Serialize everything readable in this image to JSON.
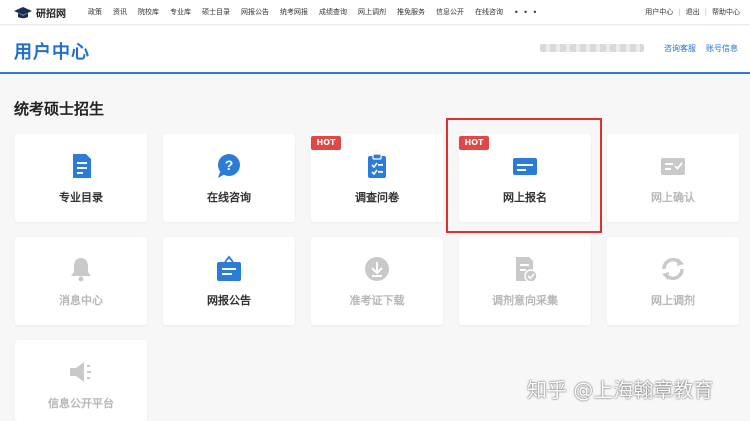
{
  "topbar": {
    "logo_text": "研招网",
    "nav_items": [
      "政策",
      "资讯",
      "院校库",
      "专业库",
      "硕士目录",
      "网报公告",
      "统考网报",
      "成绩查询",
      "网上调剂",
      "推免服务",
      "信息公开",
      "在线咨询"
    ],
    "more": "• • •",
    "right_links": [
      "用户中心",
      "退出",
      "帮助中心"
    ]
  },
  "header": {
    "title": "用户中心",
    "links": [
      "咨询客服",
      "账号信息"
    ]
  },
  "section": {
    "title": "统考硕士招生"
  },
  "hot_label": "HOT",
  "cards": [
    {
      "label": "专业目录",
      "icon": "document-list-icon",
      "hot": false,
      "disabled": false
    },
    {
      "label": "在线咨询",
      "icon": "chat-question-icon",
      "hot": false,
      "disabled": false
    },
    {
      "label": "调查问卷",
      "icon": "clipboard-check-icon",
      "hot": true,
      "disabled": false
    },
    {
      "label": "网上报名",
      "icon": "id-card-icon",
      "hot": true,
      "disabled": false
    },
    {
      "label": "网上确认",
      "icon": "id-confirm-icon",
      "hot": false,
      "disabled": true
    },
    {
      "label": "消息中心",
      "icon": "bell-icon",
      "hot": false,
      "disabled": true
    },
    {
      "label": "网报公告",
      "icon": "briefcase-notice-icon",
      "hot": false,
      "disabled": false
    },
    {
      "label": "准考证下载",
      "icon": "download-circle-icon",
      "hot": false,
      "disabled": true
    },
    {
      "label": "调剂意向采集",
      "icon": "document-check-icon",
      "hot": false,
      "disabled": true
    },
    {
      "label": "网上调剂",
      "icon": "refresh-icon",
      "hot": false,
      "disabled": true
    },
    {
      "label": "信息公开平台",
      "icon": "speaker-icon",
      "hot": false,
      "disabled": true
    }
  ],
  "colors": {
    "primary": "#2b7bd8",
    "disabled": "#c9c9c9",
    "hot": "#e04848",
    "highlight": "#e02f2f"
  },
  "watermark": "知乎 @上海翰章教育"
}
